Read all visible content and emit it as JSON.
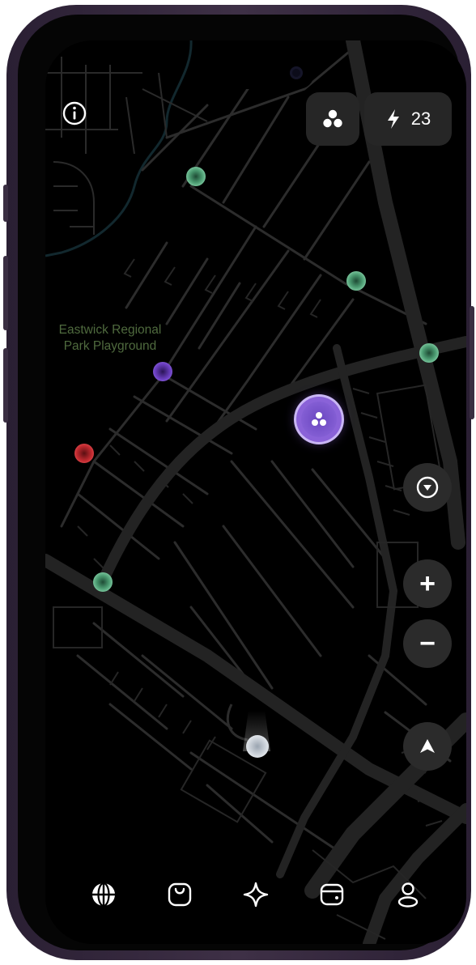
{
  "map": {
    "park_label": "Eastwick Regional\nPark Playground",
    "colors": {
      "background": "#000000",
      "street": "#2a2a2a",
      "major_road": "#222222",
      "river": "#12282e",
      "park_text": "#4f6a3e"
    },
    "markers": [
      {
        "kind": "green",
        "name": "green-marker"
      },
      {
        "kind": "green",
        "name": "green-marker"
      },
      {
        "kind": "green",
        "name": "green-marker"
      },
      {
        "kind": "green",
        "name": "green-marker"
      },
      {
        "kind": "purple",
        "name": "purple-marker"
      },
      {
        "kind": "red",
        "name": "red-marker"
      },
      {
        "kind": "user",
        "name": "user-location-marker"
      }
    ]
  },
  "header": {
    "info_icon": "info-icon",
    "group_icon": "group-icon",
    "energy_icon": "lightning-icon",
    "energy_count": "23"
  },
  "controls": {
    "compass_icon": "chevron-down-circle-icon",
    "zoom_in_label": "+",
    "zoom_out_label": "−",
    "locate_icon": "navigation-arrow-icon"
  },
  "tabbar": {
    "items": [
      {
        "icon": "globe-icon"
      },
      {
        "icon": "bag-icon"
      },
      {
        "icon": "sparkle-icon"
      },
      {
        "icon": "wallet-icon"
      },
      {
        "icon": "profile-icon"
      }
    ]
  },
  "accent_colors": {
    "cluster": "#8a62d8",
    "green_marker": "#6fd19a",
    "red_marker": "#e0353b",
    "purple_marker": "#7a4fd6",
    "button_bg": "#2b2b2b"
  }
}
